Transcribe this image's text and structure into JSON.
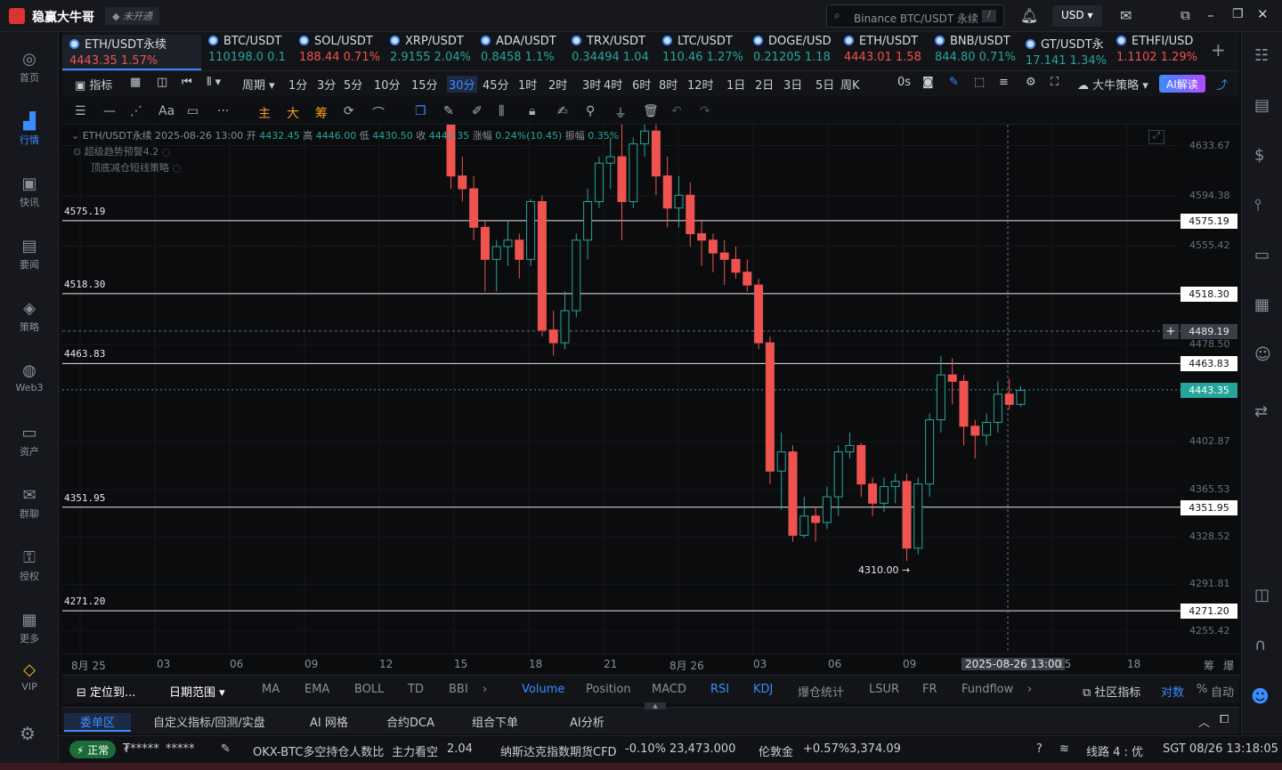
{
  "app": {
    "name": "稳赢大牛哥",
    "badge": "未开通",
    "search_placeholder": "Binance BTC/USDT 永续",
    "search_key": "/",
    "currency": "USD"
  },
  "nav": [
    {
      "label": "首页",
      "icon": "home-icon",
      "active": false
    },
    {
      "label": "行情",
      "icon": "market-icon",
      "active": true
    },
    {
      "label": "快讯",
      "icon": "news-icon",
      "active": false
    },
    {
      "label": "要闻",
      "icon": "headlines-icon",
      "active": false
    },
    {
      "label": "策略",
      "icon": "strategy-icon",
      "active": false
    },
    {
      "label": "Web3",
      "icon": "web3-icon",
      "active": false
    },
    {
      "label": "资产",
      "icon": "wallet-icon",
      "active": false
    },
    {
      "label": "群聊",
      "icon": "chat-icon",
      "active": false
    },
    {
      "label": "授权",
      "icon": "key-icon",
      "active": false
    },
    {
      "label": "更多",
      "icon": "more-icon",
      "active": false
    },
    {
      "label": "VIP",
      "icon": "vip-icon",
      "active": false
    }
  ],
  "tickers": [
    {
      "name": "ETH/USDT永续",
      "price": "4443.35",
      "change": "1.57%",
      "dir": "down",
      "active": true
    },
    {
      "name": "BTC/USDT",
      "price": "110198.0",
      "change": "0.1",
      "dir": "up"
    },
    {
      "name": "SOL/USDT",
      "price": "188.44",
      "change": "0.71%",
      "dir": "down"
    },
    {
      "name": "XRP/USDT",
      "price": "2.9155",
      "change": "2.04%",
      "dir": "up"
    },
    {
      "name": "ADA/USDT",
      "price": "0.8458",
      "change": "1.1%",
      "dir": "up"
    },
    {
      "name": "TRX/USDT",
      "price": "0.34494",
      "change": "1.04",
      "dir": "up"
    },
    {
      "name": "LTC/USDT",
      "price": "110.46",
      "change": "1.27%",
      "dir": "up"
    },
    {
      "name": "DOGE/USD",
      "price": "0.21205",
      "change": "1.18",
      "dir": "up"
    },
    {
      "name": "ETH/USDT",
      "price": "4443.01",
      "change": "1.58",
      "dir": "down"
    },
    {
      "name": "BNB/USDT",
      "price": "844.80",
      "change": "0.71%",
      "dir": "up"
    },
    {
      "name": "GT/USDT永",
      "price": "17.141",
      "change": "1.34%",
      "dir": "up"
    },
    {
      "name": "ETHFI/USD",
      "price": "1.1102",
      "change": "1.29%",
      "dir": "down"
    }
  ],
  "toolbar": {
    "indicator": "指标",
    "period": "周期",
    "intervals": [
      "1分",
      "3分",
      "5分",
      "10分",
      "15分",
      "30分",
      "45分",
      "1时",
      "2时",
      "3时",
      "4时",
      "6时",
      "8时",
      "12时",
      "1日",
      "2日",
      "3日",
      "5日",
      "周K"
    ],
    "selected_interval": "30分",
    "countdown": "0s",
    "strategy": "大牛策略",
    "ai": "AI解读"
  },
  "drawbar": [
    "主",
    "大",
    "筹"
  ],
  "info": {
    "symbol": "ETH/USDT永续",
    "time": "2025-08-26 13:00",
    "open_label": "开",
    "open": "4432.45",
    "high_label": "高",
    "high": "4446.00",
    "low_label": "低",
    "low": "4430.50",
    "close_label": "收",
    "close": "4443.35",
    "chg_label": "涨幅",
    "chg": "0.24%(10.45)",
    "amp_label": "振幅",
    "amp": "0.35%",
    "alert1": "超级趋势预警4.2",
    "alert2": "顶底减仓短线策略"
  },
  "chart_data": {
    "type": "candlestick",
    "y_range": [
      4238,
      4650
    ],
    "axis_ticks": [
      "4633.67",
      "4594.38",
      "4555.42",
      "4478.50",
      "4402.87",
      "4365.53",
      "4328.52",
      "4291.81",
      "4255.42"
    ],
    "levels": [
      "4575.19",
      "4518.30",
      "4463.83",
      "4351.95",
      "4271.20"
    ],
    "crosshair_price": "4489.19",
    "current_price": "4443.35",
    "low_marker": "4310.00",
    "candles": [
      [
        4650,
        4610,
        4668,
        4600
      ],
      [
        4610,
        4600,
        4625,
        4590
      ],
      [
        4600,
        4570,
        4610,
        4560
      ],
      [
        4570,
        4545,
        4575,
        4520
      ],
      [
        4545,
        4555,
        4560,
        4520
      ],
      [
        4555,
        4560,
        4575,
        4540
      ],
      [
        4560,
        4545,
        4565,
        4530
      ],
      [
        4545,
        4590,
        4592,
        4540
      ],
      [
        4590,
        4490,
        4595,
        4485
      ],
      [
        4490,
        4480,
        4505,
        4470
      ],
      [
        4480,
        4505,
        4520,
        4475
      ],
      [
        4505,
        4560,
        4565,
        4500
      ],
      [
        4560,
        4590,
        4600,
        4545
      ],
      [
        4590,
        4620,
        4625,
        4585
      ],
      [
        4620,
        4625,
        4640,
        4600
      ],
      [
        4625,
        4590,
        4660,
        4560
      ],
      [
        4590,
        4635,
        4640,
        4585
      ],
      [
        4635,
        4645,
        4660,
        4625
      ],
      [
        4645,
        4610,
        4650,
        4595
      ],
      [
        4610,
        4585,
        4625,
        4570
      ],
      [
        4585,
        4595,
        4610,
        4570
      ],
      [
        4595,
        4565,
        4605,
        4555
      ],
      [
        4565,
        4560,
        4575,
        4540
      ],
      [
        4560,
        4550,
        4565,
        4535
      ],
      [
        4550,
        4545,
        4560,
        4525
      ],
      [
        4545,
        4535,
        4555,
        4530
      ],
      [
        4535,
        4525,
        4545,
        4520
      ],
      [
        4525,
        4480,
        4530,
        4475
      ],
      [
        4480,
        4380,
        4485,
        4370
      ],
      [
        4380,
        4395,
        4410,
        4350
      ],
      [
        4395,
        4330,
        4400,
        4325
      ],
      [
        4330,
        4345,
        4360,
        4328
      ],
      [
        4345,
        4340,
        4352,
        4325
      ],
      [
        4340,
        4360,
        4368,
        4335
      ],
      [
        4360,
        4395,
        4400,
        4345
      ],
      [
        4395,
        4400,
        4410,
        4390
      ],
      [
        4400,
        4370,
        4402,
        4360
      ],
      [
        4370,
        4355,
        4375,
        4345
      ],
      [
        4355,
        4368,
        4375,
        4348
      ],
      [
        4368,
        4372,
        4378,
        4355
      ],
      [
        4372,
        4320,
        4378,
        4310
      ],
      [
        4320,
        4370,
        4375,
        4315
      ],
      [
        4370,
        4420,
        4425,
        4360
      ],
      [
        4420,
        4455,
        4470,
        4410
      ],
      [
        4455,
        4450,
        4468,
        4432
      ],
      [
        4450,
        4415,
        4455,
        4400
      ],
      [
        4415,
        4408,
        4420,
        4390
      ],
      [
        4408,
        4418,
        4425,
        4400
      ],
      [
        4418,
        4440,
        4450,
        4410
      ],
      [
        4440,
        4432,
        4452,
        4428
      ],
      [
        4432,
        4443,
        4446,
        4430
      ]
    ]
  },
  "time_axis": [
    "8月 25",
    "03",
    "06",
    "09",
    "12",
    "15",
    "18",
    "21",
    "8月 26",
    "03",
    "06",
    "09",
    "2025-08-26 13:00",
    "15",
    "18"
  ],
  "axis_corner": [
    "筹",
    "爆"
  ],
  "indicators_left": {
    "locate": "定位到...",
    "range": "日期范围"
  },
  "indicators": [
    "MA",
    "EMA",
    "BOLL",
    "TD",
    "BBI"
  ],
  "indicators_sub": [
    "Volume",
    "Position",
    "MACD",
    "RSI",
    "KDJ",
    "爆仓统计",
    "LSUR",
    "FR",
    "Fundflow"
  ],
  "indicators_right": {
    "community": "社区指标",
    "log": "对数",
    "pct": "%",
    "auto": "自动"
  },
  "order_tabs": [
    "委单区",
    "自定义指标/回测/实盘",
    "AI 网格",
    "合约DCA",
    "组合下单",
    "AI分析"
  ],
  "status": {
    "state": "正常",
    "masked1": "₮*****",
    "masked2": "*****",
    "ratio_text": "OKX-BTC多空持仓人数比",
    "ratio_tag": "主力看空",
    "ratio_val": "2.04",
    "nasdaq": "纳斯达克指数期货CFD",
    "nasdaq_chg": "-0.10%",
    "nasdaq_val": "23,473.000",
    "gold": "伦敦金",
    "gold_chg": "+0.57%",
    "gold_val": "3,374.09",
    "line": "线路 4 : 优",
    "clock": "SGT  08/26 13:18:05"
  }
}
